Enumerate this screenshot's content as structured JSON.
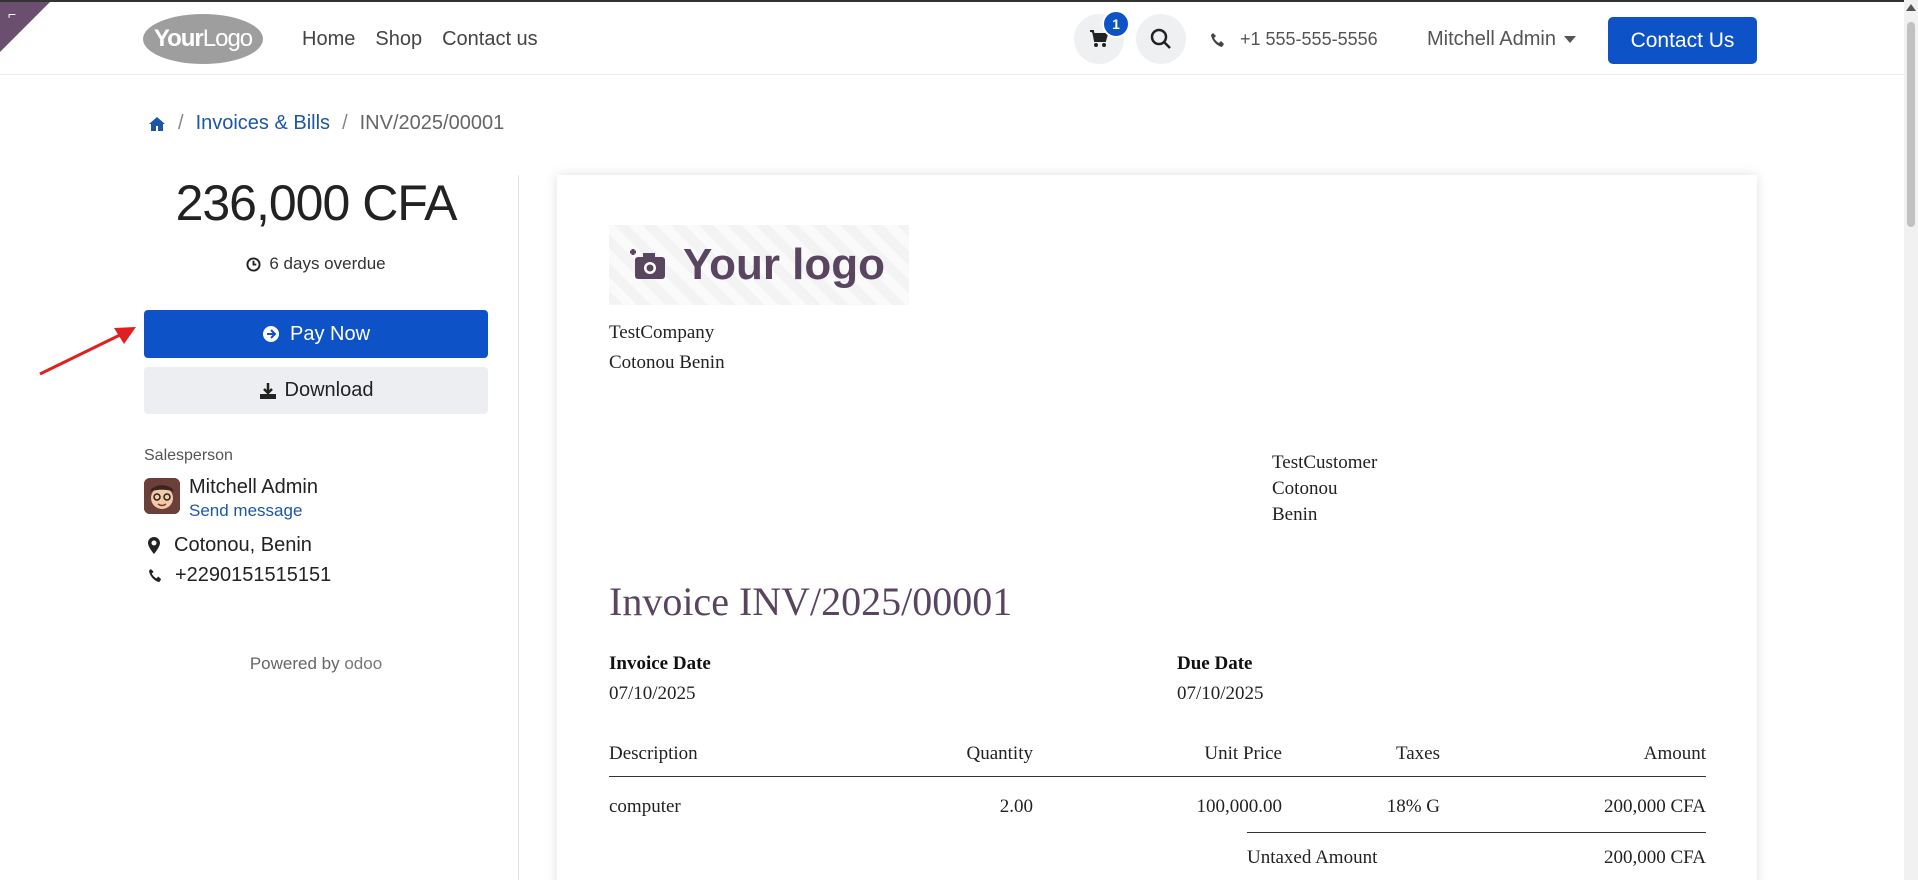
{
  "header": {
    "logo_text_bold": "Your",
    "logo_text_light": "Logo",
    "nav": [
      "Home",
      "Shop",
      "Contact us"
    ],
    "cart_count": "1",
    "phone": "+1 555-555-5556",
    "user": "Mitchell Admin",
    "contact_button": "Contact Us"
  },
  "breadcrumb": {
    "section": "Invoices & Bills",
    "current": "INV/2025/00001"
  },
  "summary": {
    "amount": "236,000 CFA",
    "overdue": "6 days overdue",
    "pay_label": "Pay Now",
    "download_label": "Download",
    "salesperson_label": "Salesperson",
    "salesperson_name": "Mitchell Admin",
    "send_message": "Send message",
    "location": "Cotonou, Benin",
    "phone": "+2290151515151",
    "powered_by": "Powered by",
    "powered_brand": "odoo"
  },
  "invoice": {
    "logo_text": "Your logo",
    "company_name": "TestCompany",
    "company_address": "Cotonou Benin",
    "customer_name": "TestCustomer",
    "customer_city": "Cotonou",
    "customer_country": "Benin",
    "title": "Invoice INV/2025/00001",
    "invoice_date_label": "Invoice Date",
    "invoice_date": "07/10/2025",
    "due_date_label": "Due Date",
    "due_date": "07/10/2025",
    "columns": {
      "description": "Description",
      "quantity": "Quantity",
      "unit_price": "Unit Price",
      "taxes": "Taxes",
      "amount": "Amount"
    },
    "lines": [
      {
        "description": "computer",
        "quantity": "2.00",
        "unit_price": "100,000.00",
        "taxes": "18% G",
        "amount": "200,000 CFA"
      }
    ],
    "untaxed_label": "Untaxed Amount",
    "untaxed_value": "200,000 CFA"
  },
  "colors": {
    "primary": "#0d52c6",
    "link": "#1c57a6",
    "invoice_accent": "#5a4561"
  }
}
